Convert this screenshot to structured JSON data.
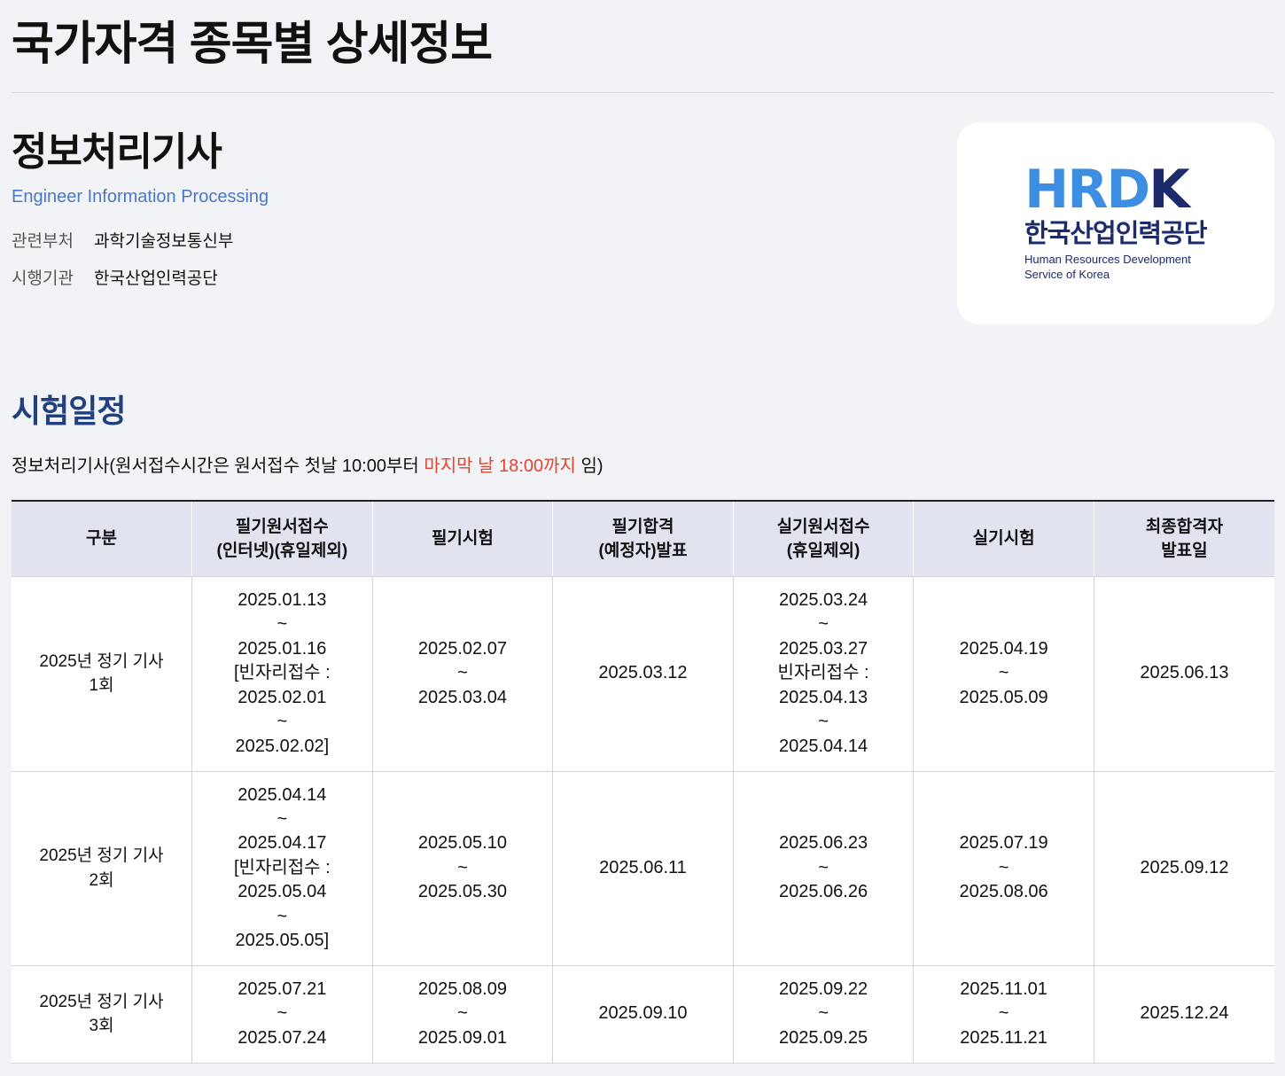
{
  "page_title": "국가자격 종목별 상세정보",
  "certificate": {
    "name": "정보처리기사",
    "english_name": "Engineer Information Processing",
    "info": [
      {
        "label": "관련부처",
        "value": "과학기술정보통신부"
      },
      {
        "label": "시행기관",
        "value": "한국산업인력공단"
      }
    ]
  },
  "logo": {
    "mark_letters": [
      "H",
      "R",
      "D",
      "K"
    ],
    "korean": "한국산업인력공단",
    "english_line1": "Human Resources Development",
    "english_line2": "Service of Korea",
    "colors": {
      "blue": "#3d8ee0",
      "navy": "#1d2a6b"
    }
  },
  "schedule": {
    "section_title": "시험일정",
    "notice_prefix": "정보처리기사(원서접수시간은 원서접수 첫날 10:00부터 ",
    "notice_highlight": "마지막 날 18:00까지",
    "notice_suffix": " 임)",
    "highlight_color": "#e0452f",
    "headers": [
      [
        "구분"
      ],
      [
        "필기원서접수",
        "(인터넷)(휴일제외)"
      ],
      [
        "필기시험"
      ],
      [
        "필기합격",
        "(예정자)발표"
      ],
      [
        "실기원서접수",
        "(휴일제외)"
      ],
      [
        "실기시험"
      ],
      [
        "최종합격자",
        "발표일"
      ]
    ],
    "rows": [
      [
        [
          "2025년 정기 기사",
          "1회"
        ],
        [
          "2025.01.13",
          "~",
          "2025.01.16",
          "[빈자리접수 :",
          "2025.02.01",
          "~",
          "2025.02.02]"
        ],
        [
          "2025.02.07",
          "~",
          "2025.03.04"
        ],
        [
          "2025.03.12"
        ],
        [
          "2025.03.24",
          "~",
          "2025.03.27",
          "빈자리접수 :",
          "2025.04.13",
          "~",
          "2025.04.14"
        ],
        [
          "2025.04.19",
          "~",
          "2025.05.09"
        ],
        [
          "2025.06.13"
        ]
      ],
      [
        [
          "2025년 정기 기사",
          "2회"
        ],
        [
          "2025.04.14",
          "~",
          "2025.04.17",
          "[빈자리접수 :",
          "2025.05.04",
          "~",
          "2025.05.05]"
        ],
        [
          "2025.05.10",
          "~",
          "2025.05.30"
        ],
        [
          "2025.06.11"
        ],
        [
          "2025.06.23",
          "~",
          "2025.06.26"
        ],
        [
          "2025.07.19",
          "~",
          "2025.08.06"
        ],
        [
          "2025.09.12"
        ]
      ],
      [
        [
          "2025년 정기 기사",
          "3회"
        ],
        [
          "2025.07.21",
          "~",
          "2025.07.24"
        ],
        [
          "2025.08.09",
          "~",
          "2025.09.01"
        ],
        [
          "2025.09.10"
        ],
        [
          "2025.09.22",
          "~",
          "2025.09.25"
        ],
        [
          "2025.11.01",
          "~",
          "2025.11.21"
        ],
        [
          "2025.12.24"
        ]
      ]
    ]
  }
}
